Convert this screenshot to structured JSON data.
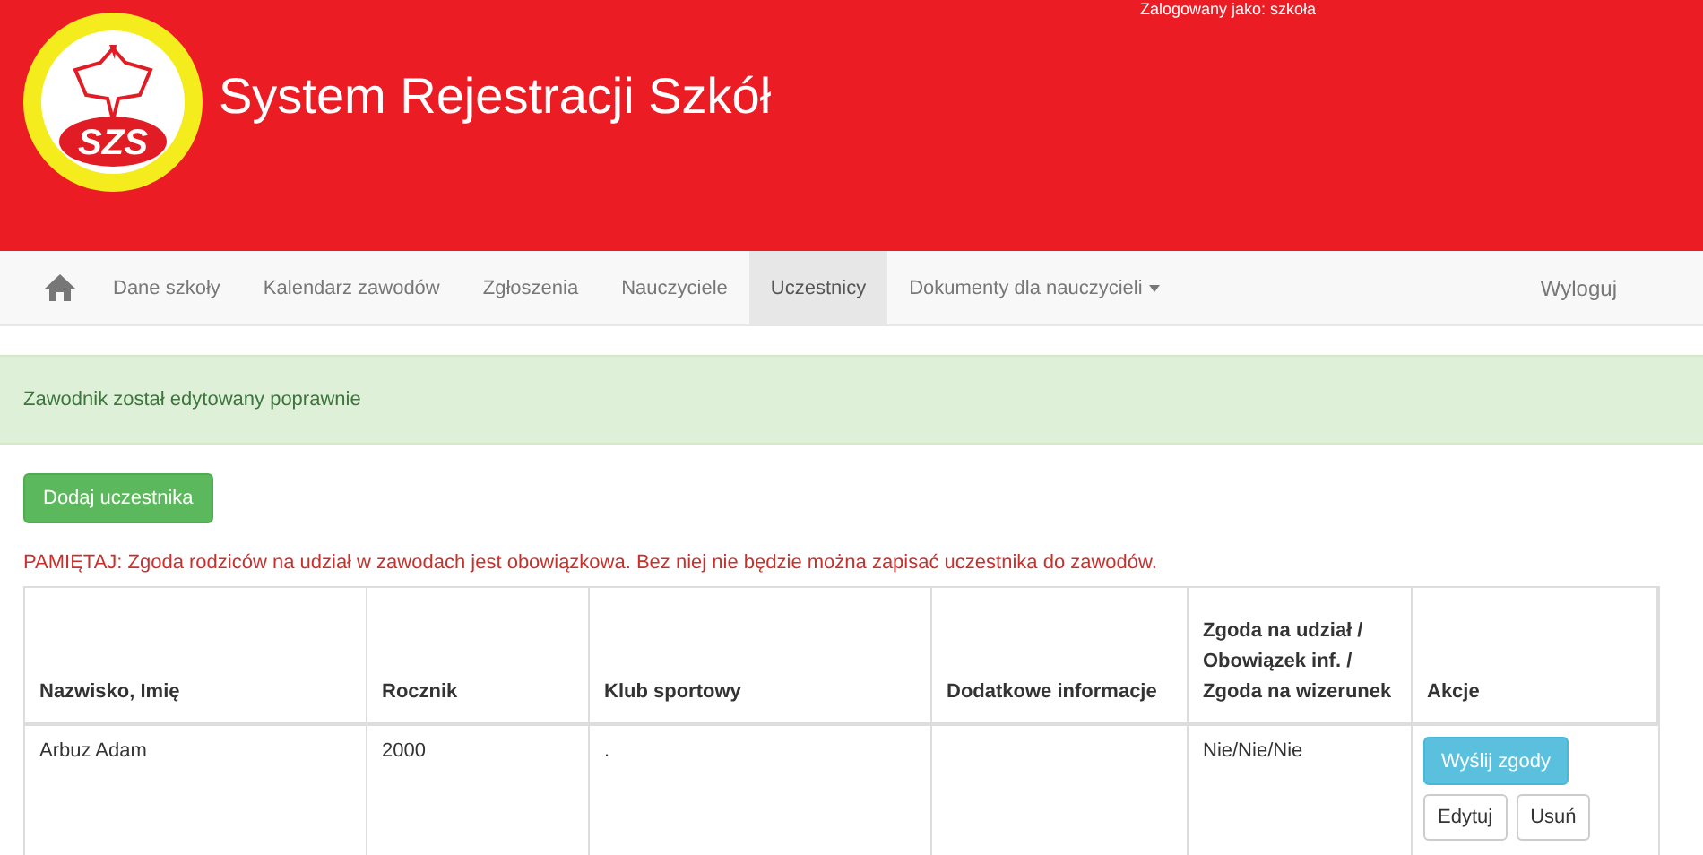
{
  "header": {
    "user_text": "Zalogowany jako: szkoła",
    "logo_text": "SZS",
    "title": "System Rejestracji Szkół"
  },
  "nav": {
    "items": [
      {
        "label": "Dane szkoły",
        "selected": false,
        "dropdown": false
      },
      {
        "label": "Kalendarz zawodów",
        "selected": false,
        "dropdown": false
      },
      {
        "label": "Zgłoszenia",
        "selected": false,
        "dropdown": false
      },
      {
        "label": "Nauczyciele",
        "selected": false,
        "dropdown": false
      },
      {
        "label": "Uczestnicy",
        "selected": true,
        "dropdown": false
      },
      {
        "label": "Dokumenty dla nauczycieli",
        "selected": false,
        "dropdown": true
      }
    ],
    "logout": "Wyloguj"
  },
  "alert": "Zawodnik został edytowany poprawnie",
  "add_button": "Dodaj uczestnika",
  "notice": "PAMIĘTAJ: Zgoda rodziców na udział w zawodach jest obowiązkowa. Bez niej nie będzie można zapisać uczestnika do zawodów.",
  "table": {
    "columns": [
      "Nazwisko, Imię",
      "Rocznik",
      "Klub sportowy",
      "Dodatkowe informacje",
      "Zgoda na udział / Obowiązek inf. / Zgoda na wizerunek",
      "Akcje"
    ],
    "rows": [
      {
        "cells": [
          "Arbuz Adam",
          "2000",
          ".",
          "",
          "Nie/Nie/Nie"
        ],
        "actions": {
          "send": "Wyślij zgody",
          "edit": "Edytuj",
          "delete": "Usuń"
        }
      }
    ]
  }
}
